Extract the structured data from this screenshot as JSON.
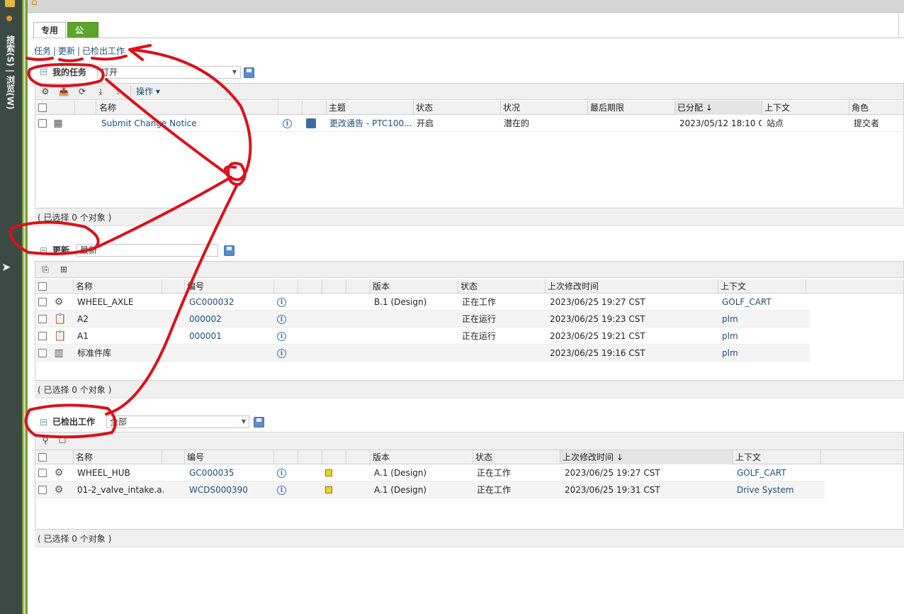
{
  "rail": {
    "vertical_text": "搜索(S) | 浏览(W)"
  },
  "tabs": [
    {
      "label": "专用"
    },
    {
      "label": "公用"
    }
  ],
  "nav": {
    "tasks": "任务",
    "updates": "更新",
    "checked_out": "已检出工作",
    "sep": "|"
  },
  "tasks_section": {
    "title": "我的任务",
    "filter_value": "打开",
    "actions_label": "操作",
    "columns": [
      "名称",
      "主题",
      "状态",
      "状况",
      "最后期限",
      "已分配 ↓",
      "上下文",
      "角色"
    ],
    "rows": [
      {
        "name": "Submit Change Notice",
        "subject": "更改通告 - PTC100...",
        "state": "开启",
        "status": "潜在的",
        "deadline": "",
        "assigned": "2023/05/12 18:10 C...",
        "context": "站点",
        "role": "提交者"
      }
    ],
    "footer": "( 已选择 0 个对象 )"
  },
  "updates_section": {
    "title": "更新",
    "filter_value": "最新",
    "columns": [
      "名称",
      "编号",
      "版本",
      "状态",
      "上次修改时间",
      "上下文"
    ],
    "rows": [
      {
        "name": "WHEEL_AXLE",
        "number": "GC000032",
        "version": "B.1 (Design)",
        "state": "正在工作",
        "modified": "2023/06/25 19:27 CST",
        "context": "GOLF_CART",
        "icon": "gear-icon"
      },
      {
        "name": "A2",
        "number": "000002",
        "version": "",
        "state": "正在运行",
        "modified": "2023/06/25 19:23 CST",
        "context": "plm",
        "icon": "clipboard-icon"
      },
      {
        "name": "A1",
        "number": "000001",
        "version": "",
        "state": "正在运行",
        "modified": "2023/06/25 19:21 CST",
        "context": "plm",
        "icon": "clipboard-icon"
      },
      {
        "name": "标准件库",
        "number": "",
        "version": "",
        "state": "",
        "modified": "2023/06/25 19:16 CST",
        "context": "plm",
        "icon": "library-icon"
      }
    ],
    "footer": "( 已选择 0 个对象 )"
  },
  "checkout_section": {
    "title": "已检出工作",
    "filter_value": "全部",
    "columns": [
      "名称",
      "编号",
      "版本",
      "状态",
      "上次修改时间 ↓",
      "上下文"
    ],
    "rows": [
      {
        "name": "WHEEL_HUB",
        "number": "GC000035",
        "version": "A.1 (Design)",
        "state": "正在工作",
        "modified": "2023/06/25 19:27 CST",
        "context": "GOLF_CART"
      },
      {
        "name": "01-2_valve_intake.a...",
        "number": "WCDS000390",
        "version": "A.1 (Design)",
        "state": "正在工作",
        "modified": "2023/06/25 19:31 CST",
        "context": "Drive System"
      }
    ],
    "footer": "( 已选择 0 个对象 )"
  },
  "colors": {
    "accent_green": "#5aa52a",
    "link_blue": "#1f4e7a",
    "annotation_red": "#d8121b"
  }
}
